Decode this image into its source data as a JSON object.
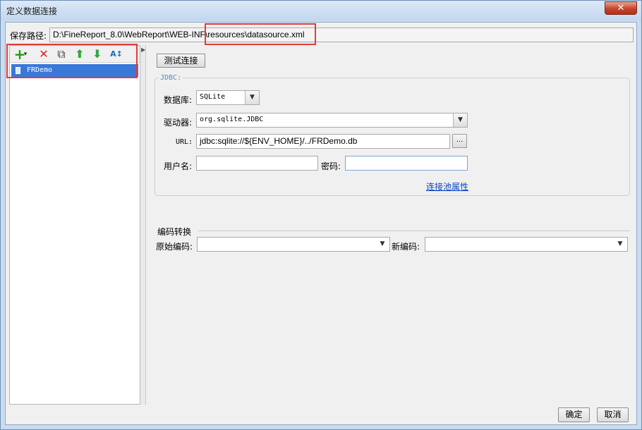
{
  "window": {
    "title": "定义数据连接",
    "close_glyph": "✕"
  },
  "path": {
    "label": "保存路径:",
    "value": "D:\\FineReport_8.0\\WebReport\\WEB-INF\\resources\\datasource.xml"
  },
  "toolbar": {
    "add_glyph": "+",
    "add_dropdown_glyph": "▾",
    "delete_glyph": "✕",
    "copy_glyph": "⧉",
    "move_up_glyph": "⬆",
    "move_down_glyph": "⬇",
    "sort_glyph": "A↕"
  },
  "tree": {
    "items": [
      {
        "label": "FRDemo",
        "icon": "database-icon",
        "selected": true
      }
    ]
  },
  "test_button": "测试连接",
  "jdbc": {
    "legend": "JDBC:",
    "database_label": "数据库:",
    "database_value": "SQLite",
    "driver_label": "驱动器:",
    "driver_value": "org.sqlite.JDBC",
    "url_label": "URL:",
    "url_value": "jdbc:sqlite://${ENV_HOME}/../FRDemo.db",
    "url_button": "...",
    "username_label": "用户名:",
    "username_value": "",
    "password_label": "密码:",
    "password_value": "",
    "pool_link": "连接池属性"
  },
  "encoding": {
    "legend": "编码转换",
    "original_label": "原始编码:",
    "original_value": "",
    "new_label": "新编码:",
    "new_value": ""
  },
  "arrow_glyph": "▼",
  "buttons": {
    "ok": "确定",
    "cancel": "取消"
  },
  "colors": {
    "highlight": "#e23b3b",
    "selection": "#3a78d8",
    "link": "#0b43c4",
    "add": "#1aa01a",
    "delete": "#e02020",
    "arrows": "#2fa83a"
  }
}
